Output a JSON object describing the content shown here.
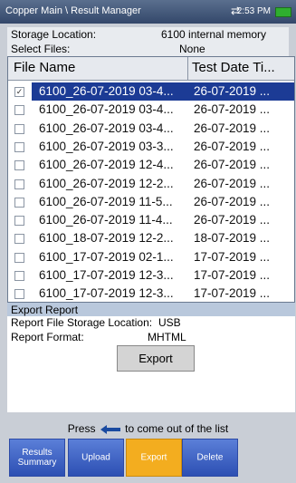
{
  "titlebar": {
    "title": "Copper Main \\ Result Manager",
    "sync_icon": "⇄",
    "time": "2:53 PM",
    "battery_icon": "battery-icon"
  },
  "storage": {
    "label": "Storage Location:",
    "value": "6100 internal memory"
  },
  "select_files": {
    "label": "Select Files:",
    "value": "None"
  },
  "table": {
    "col_file": "File Name",
    "col_date": "Test Date Ti...",
    "rows": [
      {
        "checked": "✓",
        "file": "6100_26-07-2019 03-4...",
        "date": "26-07-2019 ..."
      },
      {
        "checked": "",
        "file": "6100_26-07-2019 03-4...",
        "date": "26-07-2019 ..."
      },
      {
        "checked": "",
        "file": "6100_26-07-2019 03-4...",
        "date": "26-07-2019 ..."
      },
      {
        "checked": "",
        "file": "6100_26-07-2019 03-3...",
        "date": "26-07-2019 ..."
      },
      {
        "checked": "",
        "file": "6100_26-07-2019 12-4...",
        "date": "26-07-2019 ..."
      },
      {
        "checked": "",
        "file": "6100_26-07-2019 12-2...",
        "date": "26-07-2019 ..."
      },
      {
        "checked": "",
        "file": "6100_26-07-2019 11-5...",
        "date": "26-07-2019 ..."
      },
      {
        "checked": "",
        "file": "6100_26-07-2019 11-4...",
        "date": "26-07-2019 ..."
      },
      {
        "checked": "",
        "file": "6100_18-07-2019 12-2...",
        "date": "18-07-2019 ..."
      },
      {
        "checked": "",
        "file": "6100_17-07-2019 02-1...",
        "date": "17-07-2019 ..."
      },
      {
        "checked": "",
        "file": "6100_17-07-2019 12-3...",
        "date": "17-07-2019 ..."
      },
      {
        "checked": "",
        "file": "6100_17-07-2019 12-3...",
        "date": "17-07-2019 ..."
      }
    ]
  },
  "export_report": {
    "heading": "Export Report",
    "storage_label": "Report File Storage Location:",
    "storage_value": "USB",
    "format_label": "Report Format:",
    "format_value": "MHTML",
    "button": "Export"
  },
  "hint": {
    "before": "Press",
    "after": "to come out of the list"
  },
  "nav": {
    "results_summary": "Results Summary",
    "upload": "Upload",
    "export": "Export",
    "delete": "Delete"
  }
}
